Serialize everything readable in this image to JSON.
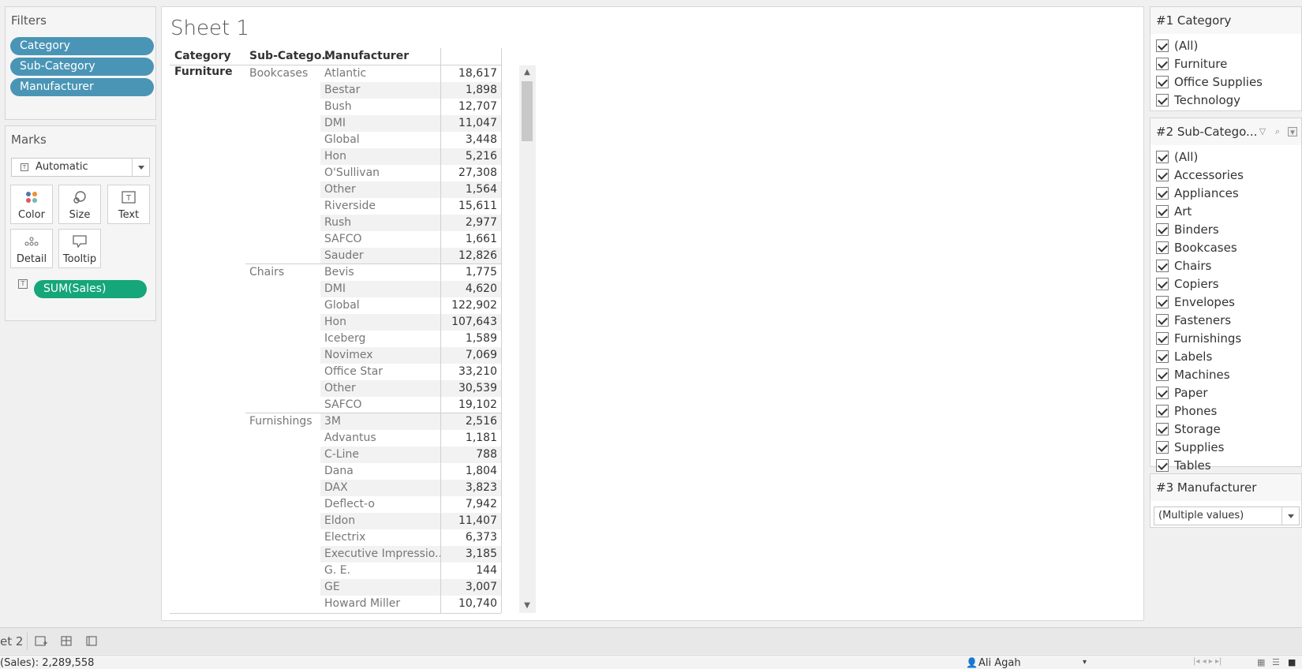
{
  "filters_panel": {
    "title": "Filters",
    "pills": [
      "Category",
      "Sub-Category",
      "Manufacturer"
    ]
  },
  "marks_panel": {
    "title": "Marks",
    "mark_type": "Automatic",
    "buttons": [
      {
        "label": "Color",
        "icon": "color-dots-icon"
      },
      {
        "label": "Size",
        "icon": "size-shape-icon"
      },
      {
        "label": "Text",
        "icon": "text-box-icon"
      },
      {
        "label": "Detail",
        "icon": "detail-dots-icon"
      },
      {
        "label": "Tooltip",
        "icon": "tooltip-bubble-icon"
      }
    ],
    "measure_pill": "SUM(Sales)"
  },
  "sheet": {
    "title": "Sheet 1",
    "headers": {
      "category": "Category",
      "subcategory": "Sub-Catego..",
      "manufacturer": "Manufacturer"
    },
    "category": "Furniture",
    "groups": [
      {
        "subcategory": "Bookcases",
        "rows": [
          {
            "m": "Atlantic",
            "v": "18,617"
          },
          {
            "m": "Bestar",
            "v": "1,898"
          },
          {
            "m": "Bush",
            "v": "12,707"
          },
          {
            "m": "DMI",
            "v": "11,047"
          },
          {
            "m": "Global",
            "v": "3,448"
          },
          {
            "m": "Hon",
            "v": "5,216"
          },
          {
            "m": "O'Sullivan",
            "v": "27,308"
          },
          {
            "m": "Other",
            "v": "1,564"
          },
          {
            "m": "Riverside",
            "v": "15,611"
          },
          {
            "m": "Rush",
            "v": "2,977"
          },
          {
            "m": "SAFCO",
            "v": "1,661"
          },
          {
            "m": "Sauder",
            "v": "12,826"
          }
        ]
      },
      {
        "subcategory": "Chairs",
        "rows": [
          {
            "m": "Bevis",
            "v": "1,775"
          },
          {
            "m": "DMI",
            "v": "4,620"
          },
          {
            "m": "Global",
            "v": "122,902"
          },
          {
            "m": "Hon",
            "v": "107,643"
          },
          {
            "m": "Iceberg",
            "v": "1,589"
          },
          {
            "m": "Novimex",
            "v": "7,069"
          },
          {
            "m": "Office Star",
            "v": "33,210"
          },
          {
            "m": "Other",
            "v": "30,539"
          },
          {
            "m": "SAFCO",
            "v": "19,102"
          }
        ]
      },
      {
        "subcategory": "Furnishings",
        "rows": [
          {
            "m": "3M",
            "v": "2,516"
          },
          {
            "m": "Advantus",
            "v": "1,181"
          },
          {
            "m": "C-Line",
            "v": "788"
          },
          {
            "m": "Dana",
            "v": "1,804"
          },
          {
            "m": "DAX",
            "v": "3,823"
          },
          {
            "m": "Deflect-o",
            "v": "7,942"
          },
          {
            "m": "Eldon",
            "v": "11,407"
          },
          {
            "m": "Electrix",
            "v": "6,373"
          },
          {
            "m": "Executive Impressio..",
            "v": "3,185"
          },
          {
            "m": "G. E.",
            "v": "144"
          },
          {
            "m": "GE",
            "v": "3,007"
          },
          {
            "m": "Howard Miller",
            "v": "10,740"
          }
        ]
      }
    ]
  },
  "filter_cards": {
    "category": {
      "title": "#1 Category",
      "options": [
        "(All)",
        "Furniture",
        "Office Supplies",
        "Technology"
      ]
    },
    "subcategory": {
      "title": "#2 Sub-Catego...",
      "options": [
        "(All)",
        "Accessories",
        "Appliances",
        "Art",
        "Binders",
        "Bookcases",
        "Chairs",
        "Copiers",
        "Envelopes",
        "Fasteners",
        "Furnishings",
        "Labels",
        "Machines",
        "Paper",
        "Phones",
        "Storage",
        "Supplies",
        "Tables"
      ]
    },
    "manufacturer": {
      "title": "#3 Manufacturer",
      "value": "(Multiple values)"
    }
  },
  "tabbar": {
    "sheet_tab": "et 2"
  },
  "statusbar": {
    "summary": "(Sales): 2,289,558",
    "user": "Ali Agah"
  }
}
